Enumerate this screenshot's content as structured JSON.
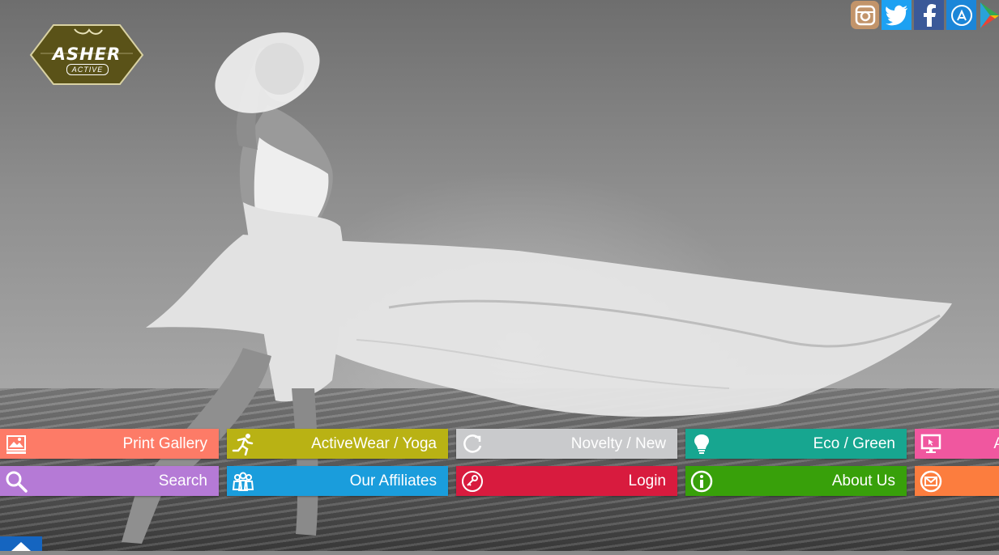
{
  "logo": {
    "word": "ASHER",
    "sub": "ACTIVE",
    "color": "#5a5218"
  },
  "social": [
    {
      "name": "instagram-icon",
      "color": "#c2946a"
    },
    {
      "name": "twitter-icon",
      "color": "#1da1f2"
    },
    {
      "name": "facebook-icon",
      "color": "#3b5998"
    },
    {
      "name": "app-store-icon",
      "color": "#1c86d8"
    },
    {
      "name": "google-play-icon",
      "color": "#34a853"
    }
  ],
  "tiles": {
    "row1": [
      {
        "label": "Print Gallery",
        "icon": "gallery-icon",
        "color": "#fd7b67"
      },
      {
        "label": "ActiveWear / Yoga",
        "icon": "runner-icon",
        "color": "#b9b214"
      },
      {
        "label": "Novelty / New",
        "icon": "refresh-icon",
        "color": "#c9cacc"
      },
      {
        "label": "Eco / Green",
        "icon": "lightbulb-icon",
        "color": "#17a690"
      },
      {
        "label": "A",
        "icon": "monitor-icon",
        "color": "#f0579f"
      }
    ],
    "row2": [
      {
        "label": "Search",
        "icon": "search-icon",
        "color": "#b57ad6"
      },
      {
        "label": "Our Affiliates",
        "icon": "people-icon",
        "color": "#1a9ddc"
      },
      {
        "label": "Login",
        "icon": "key-icon",
        "color": "#d81b3e"
      },
      {
        "label": "About Us",
        "icon": "info-icon",
        "color": "#38a00a"
      },
      {
        "label": "",
        "icon": "mail-icon",
        "color": "#fc7d3e"
      }
    ]
  },
  "home_tab": {
    "icon": "home-icon",
    "color": "#1565c0"
  }
}
